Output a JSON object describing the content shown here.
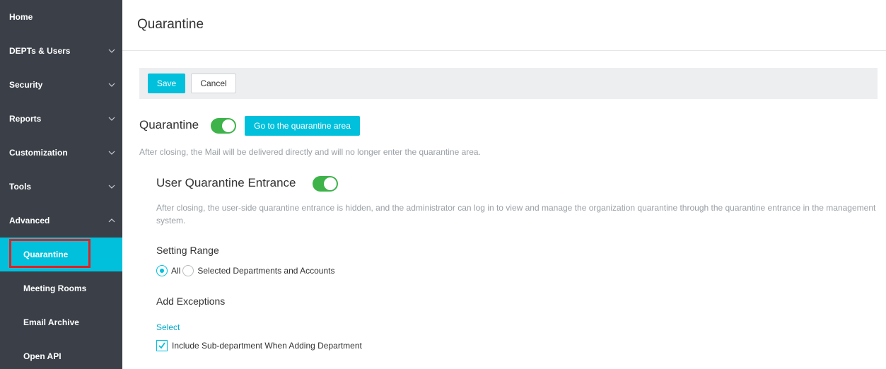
{
  "sidebar": {
    "items": [
      {
        "label": "Home"
      },
      {
        "label": "DEPTs & Users"
      },
      {
        "label": "Security"
      },
      {
        "label": "Reports"
      },
      {
        "label": "Customization"
      },
      {
        "label": "Tools"
      },
      {
        "label": "Advanced"
      }
    ],
    "sub_items": [
      {
        "label": "Quarantine"
      },
      {
        "label": "Meeting Rooms"
      },
      {
        "label": "Email Archive"
      },
      {
        "label": "Open API"
      }
    ]
  },
  "header": {
    "title": "Quarantine"
  },
  "toolbar": {
    "save_label": "Save",
    "cancel_label": "Cancel"
  },
  "quarantine": {
    "title": "Quarantine",
    "toggle_on": true,
    "goto_label": "Go to the quarantine area",
    "description": "After closing, the Mail will be delivered directly and will no longer enter the quarantine area."
  },
  "user_entrance": {
    "title": "User Quarantine Entrance",
    "toggle_on": true,
    "description": "After closing, the user-side quarantine entrance is hidden, and the administrator can log in to view and manage the organization quarantine through the quarantine entrance in the management system."
  },
  "setting_range": {
    "label": "Setting Range",
    "options": [
      "All",
      "Selected Departments and Accounts"
    ],
    "selected": "All"
  },
  "exceptions": {
    "label": "Add Exceptions",
    "select_label": "Select",
    "include_sub_label": "Include Sub-department When Adding Department",
    "include_sub_checked": true
  },
  "colors": {
    "accent": "#00c0dc",
    "toggle_on": "#3db34a",
    "sidebar_bg": "#3a3f48",
    "highlight_border": "#e02020"
  }
}
